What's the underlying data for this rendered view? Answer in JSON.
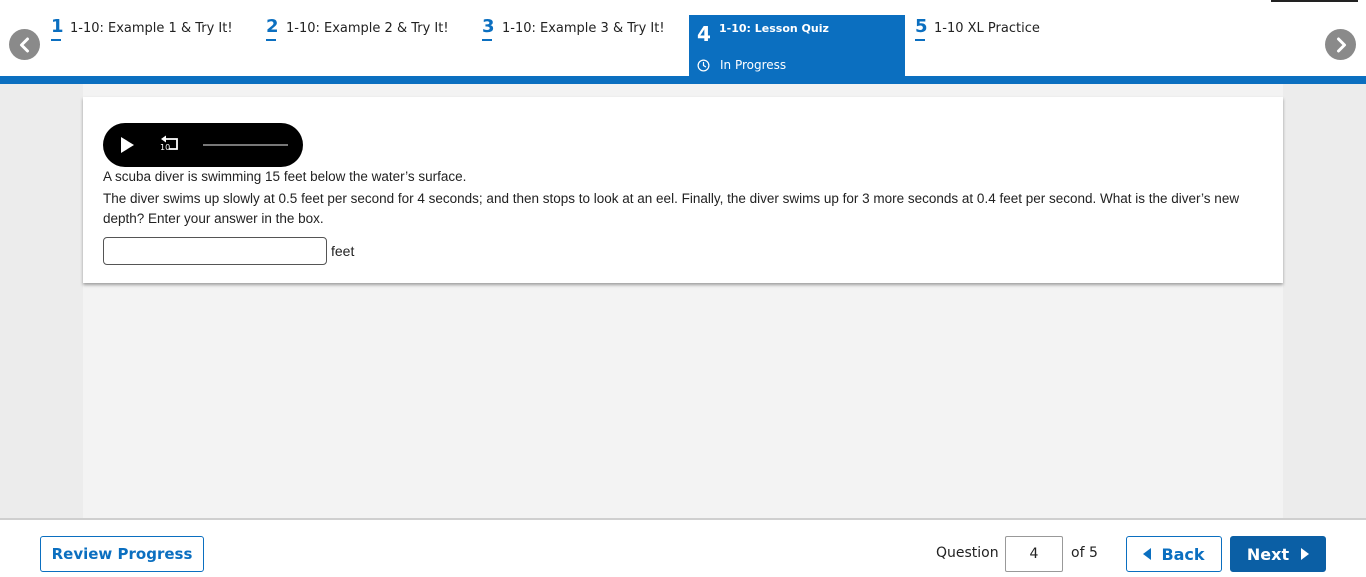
{
  "nav": {
    "tabs": [
      {
        "number": "1",
        "label": "1-10: Example 1 & Try It!"
      },
      {
        "number": "2",
        "label": "1-10: Example 2 & Try It!"
      },
      {
        "number": "3",
        "label": "1-10: Example 3 & Try It!"
      },
      {
        "number": "4",
        "label": "1-10: Lesson Quiz",
        "status": "In Progress",
        "active": true
      },
      {
        "number": "5",
        "label": "1-10 XL Practice"
      }
    ],
    "prev_icon": "chevron-left-icon",
    "next_icon": "chevron-right-icon",
    "accent_color": "#0b6fc0"
  },
  "audio": {
    "play_icon": "play-icon",
    "replay_icon": "replay-10-icon",
    "replay_label": "10"
  },
  "question": {
    "line1": "A scuba diver is swimming 15 feet below the water’s surface.",
    "line2": "The diver swims up slowly at 0.5 feet per second for 4 seconds; and then stops to look at an eel. Finally, the diver swims up for 3 more seconds at 0.4 feet per second. What is the diver’s new depth? Enter your answer in the box.",
    "answer_value": "",
    "unit": "feet"
  },
  "footer": {
    "review_label": "Review Progress",
    "question_label": "Question",
    "question_number": "4",
    "of_label": "of 5",
    "back_label": "Back",
    "next_label": "Next"
  }
}
